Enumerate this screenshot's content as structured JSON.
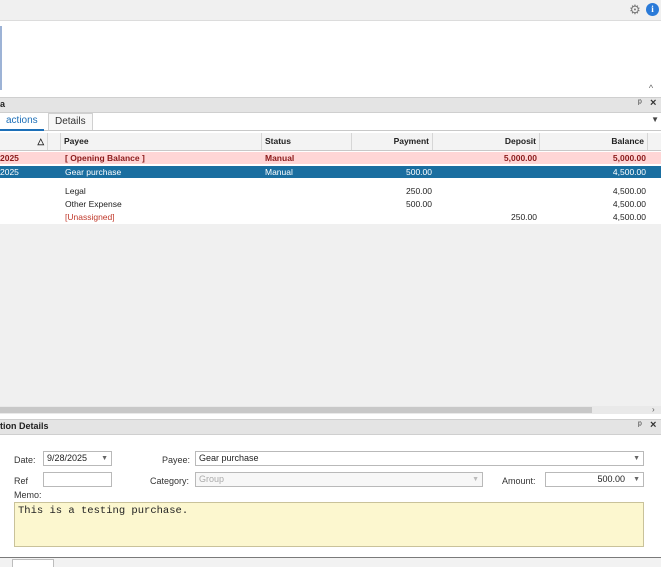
{
  "toolbar": {
    "settings_icon": "gear-icon",
    "info_icon": "info-icon",
    "info_glyph": "i"
  },
  "register_panel": {
    "title": "a",
    "tabs": [
      "actions",
      "Details"
    ],
    "columns": {
      "sort": "△",
      "payee": "Payee",
      "status": "Status",
      "payment": "Payment",
      "deposit": "Deposit",
      "balance": "Balance"
    },
    "rows": [
      {
        "date": "2025",
        "payee": "[ Opening Balance ]",
        "status": "Manual",
        "payment": "",
        "deposit": "5,000.00",
        "balance": "5,000.00"
      },
      {
        "date": "2025",
        "payee": "Gear purchase",
        "status": "Manual",
        "payment": "500.00",
        "deposit": "",
        "balance": "4,500.00"
      },
      {
        "date": "",
        "payee": "Legal",
        "status": "",
        "payment": "250.00",
        "deposit": "",
        "balance": "4,500.00"
      },
      {
        "date": "",
        "payee": "Other Expense",
        "status": "",
        "payment": "500.00",
        "deposit": "",
        "balance": "4,500.00"
      },
      {
        "date": "",
        "payee": "[Unassigned]",
        "status": "",
        "payment": "",
        "deposit": "250.00",
        "balance": "4,500.00"
      }
    ],
    "colors": {
      "opening_row_bg": "#ffd6d6",
      "selected_row_bg": "#1a6ea0",
      "unassigned_text": "#c0392b"
    }
  },
  "details_panel": {
    "title": "tion Details",
    "date_label": "Date:",
    "date_value": "9/28/2025",
    "payee_label": "Payee:",
    "payee_value": "Gear purchase",
    "ref_label": "Ref",
    "ref_value": "",
    "category_label": "Category:",
    "category_placeholder": "Group",
    "amount_label": "Amount:",
    "amount_value": "500.00",
    "memo_label": "Memo:",
    "memo_value": "This is a testing purchase."
  },
  "glyphs": {
    "pin": "ᵖ",
    "close": "×",
    "caret_up": "^",
    "dropdown": "▼",
    "scroll_right": "›"
  }
}
